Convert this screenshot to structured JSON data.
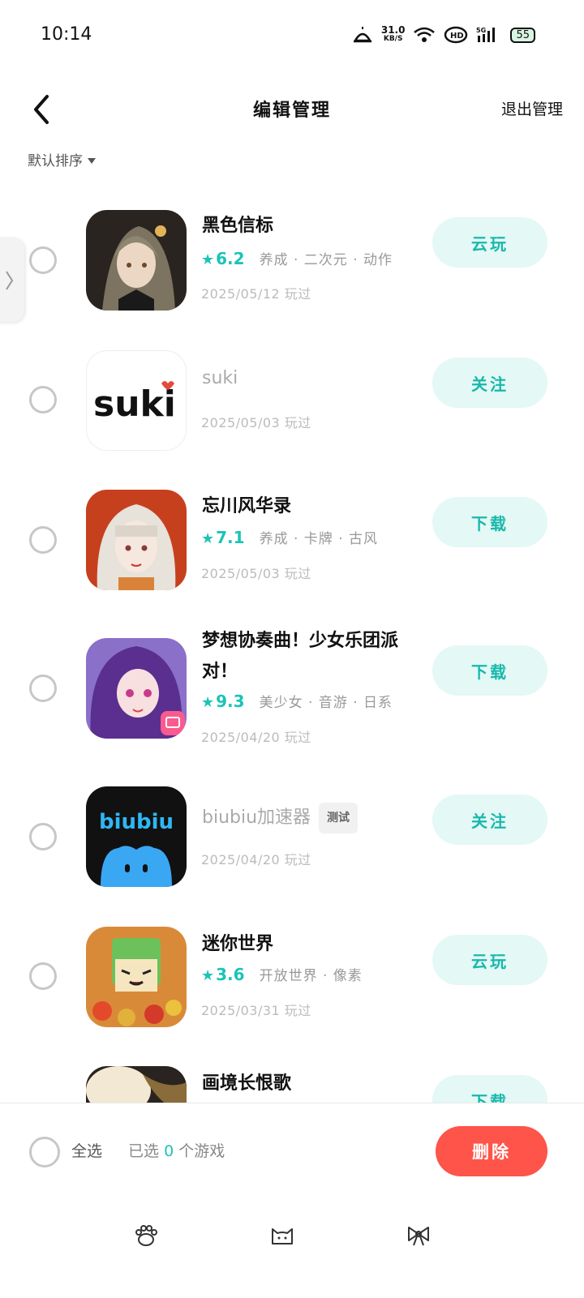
{
  "status_bar": {
    "time": "10:14",
    "speed_value": "31.0",
    "speed_unit": "KB/S",
    "battery": "55"
  },
  "header": {
    "title": "编辑管理",
    "exit_label": "退出管理"
  },
  "sort": {
    "label": "默认排序"
  },
  "games": [
    {
      "name": "黑色信标",
      "score": "6.2",
      "tags": "养成 · 二次元 · 动作",
      "date": "2025/05/12 玩过",
      "action": "云玩"
    },
    {
      "name": "suki",
      "score": "",
      "tags": "",
      "date": "2025/05/03 玩过",
      "action": "关注",
      "icon_text": "suki"
    },
    {
      "name": "忘川风华录",
      "score": "7.1",
      "tags": "养成 · 卡牌 · 古风",
      "date": "2025/05/03 玩过",
      "action": "下载"
    },
    {
      "name": "梦想协奏曲！少女乐团派对！",
      "score": "9.3",
      "tags": "美少女 · 音游 · 日系",
      "date": "2025/04/20 玩过",
      "action": "下载"
    },
    {
      "name": "biubiu加速器",
      "badge": "测试",
      "score": "",
      "tags": "",
      "date": "2025/04/20 玩过",
      "action": "关注",
      "icon_text": "biubiu"
    },
    {
      "name": "迷你世界",
      "score": "3.6",
      "tags": "开放世界 · 像素",
      "date": "2025/03/31 玩过",
      "action": "云玩"
    },
    {
      "name": "画境长恨歌",
      "action": "下载"
    }
  ],
  "footer": {
    "select_all": "全选",
    "selected_prefix": "已选",
    "selected_count": "0",
    "selected_suffix": "个游戏",
    "delete_label": "删除"
  },
  "colors": {
    "accent": "#1cc3b7",
    "action_bg": "#e4f8f5",
    "delete": "#fe5449"
  },
  "icons": [
    "back-icon",
    "sort-arrow-icon",
    "paw-icon",
    "cat-icon",
    "bow-icon"
  ]
}
